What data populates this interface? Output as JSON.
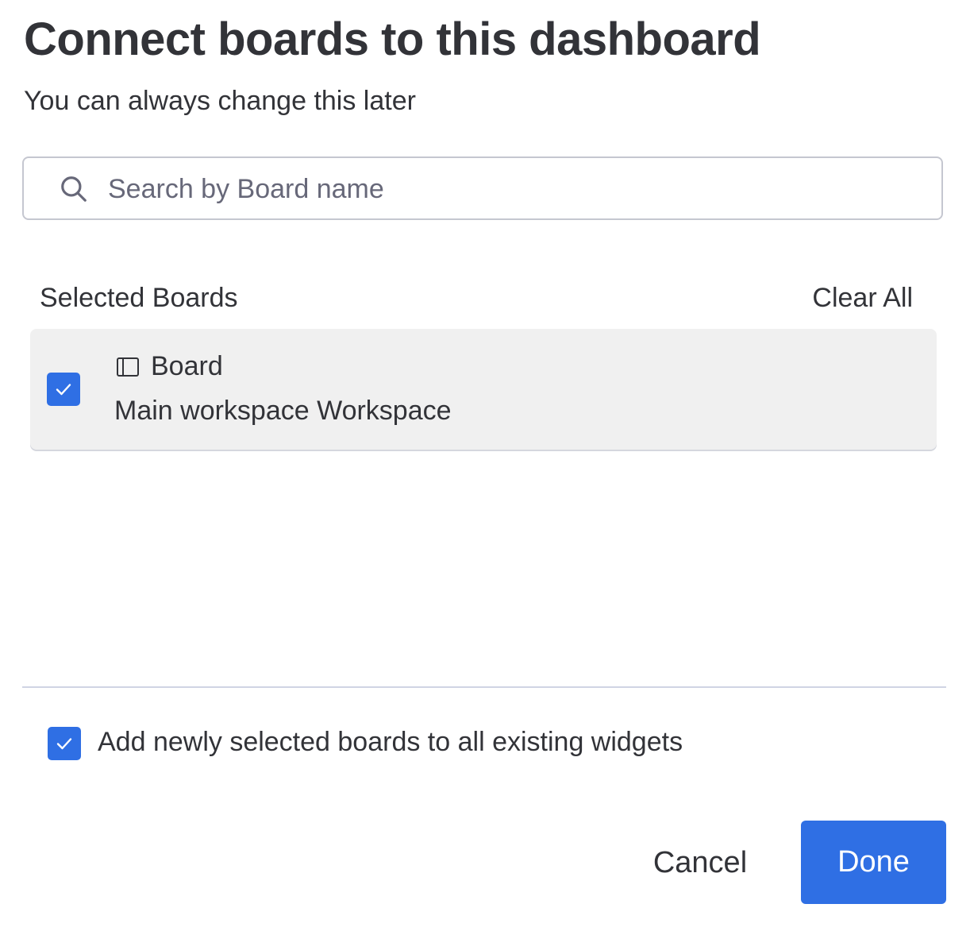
{
  "dialog": {
    "title": "Connect boards to this dashboard",
    "subtitle": "You can always change this later"
  },
  "search": {
    "placeholder": "Search by Board name",
    "value": "",
    "icon": "search-icon"
  },
  "selected_boards": {
    "label": "Selected Boards",
    "clear_all_label": "Clear All",
    "items": [
      {
        "name": "Board",
        "workspace": "Main workspace Workspace",
        "checked": true,
        "icon": "board-icon"
      }
    ]
  },
  "options": {
    "add_to_widgets_label": "Add newly selected boards to all existing widgets",
    "add_to_widgets_checked": true
  },
  "actions": {
    "cancel_label": "Cancel",
    "done_label": "Done"
  },
  "colors": {
    "primary": "#2f6fe4",
    "text": "#323338",
    "row_background": "#f0f0f0",
    "border": "#c5c7d0"
  }
}
